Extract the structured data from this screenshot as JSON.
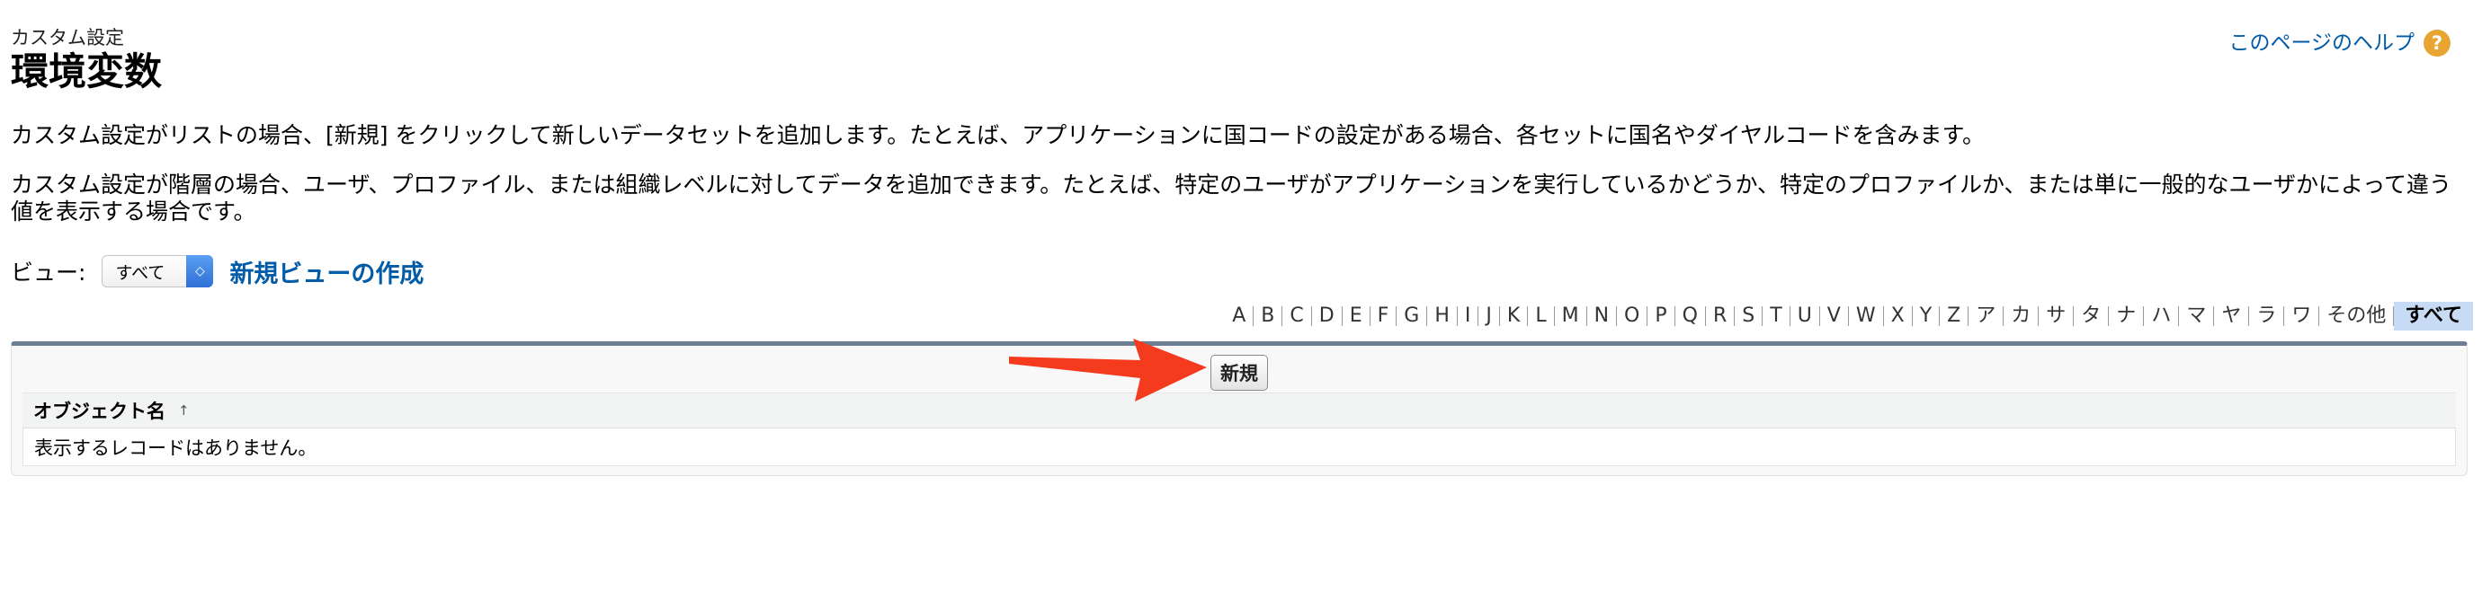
{
  "header": {
    "breadcrumb": "カスタム設定",
    "title": "環境変数",
    "help_link": "このページのヘルプ",
    "help_icon": "?"
  },
  "description": {
    "paragraph1": "カスタム設定がリストの場合、[新規] をクリックして新しいデータセットを追加します。たとえば、アプリケーションに国コードの設定がある場合、各セットに国名やダイヤルコードを含みます。",
    "paragraph2": "カスタム設定が階層の場合、ユーザ、プロファイル、または組織レベルに対してデータを追加できます。たとえば、特定のユーザがアプリケーションを実行しているかどうか、特定のプロファイルか、または単に一般的なユーザかによって違う値を表示する場合です。"
  },
  "view": {
    "label": "ビュー:",
    "selected": "すべて",
    "create_link": "新規ビューの作成"
  },
  "alphabet_filter": {
    "letters": [
      "A",
      "B",
      "C",
      "D",
      "E",
      "F",
      "G",
      "H",
      "I",
      "J",
      "K",
      "L",
      "M",
      "N",
      "O",
      "P",
      "Q",
      "R",
      "S",
      "T",
      "U",
      "V",
      "W",
      "X",
      "Y",
      "Z",
      "ア",
      "カ",
      "サ",
      "タ",
      "ナ",
      "ハ",
      "マ",
      "ヤ",
      "ラ",
      "ワ",
      "その他",
      "すべて"
    ],
    "selected": "すべて"
  },
  "list": {
    "new_button": "新規",
    "column_header": "オブジェクト名",
    "sort_indicator": "↑",
    "empty_message": "表示するレコードはありません。"
  },
  "colors": {
    "link": "#015ba7",
    "panel_border": "#6b7e94",
    "help_icon": "#e8a532",
    "annotation_arrow": "#f43b1e",
    "selected_filter": "#c7dcf4"
  },
  "icons": {
    "help": "help-circle-icon",
    "select": "updown-chevron-icon",
    "sort": "sort-ascending-icon",
    "annotation": "red-arrow-annotation"
  }
}
